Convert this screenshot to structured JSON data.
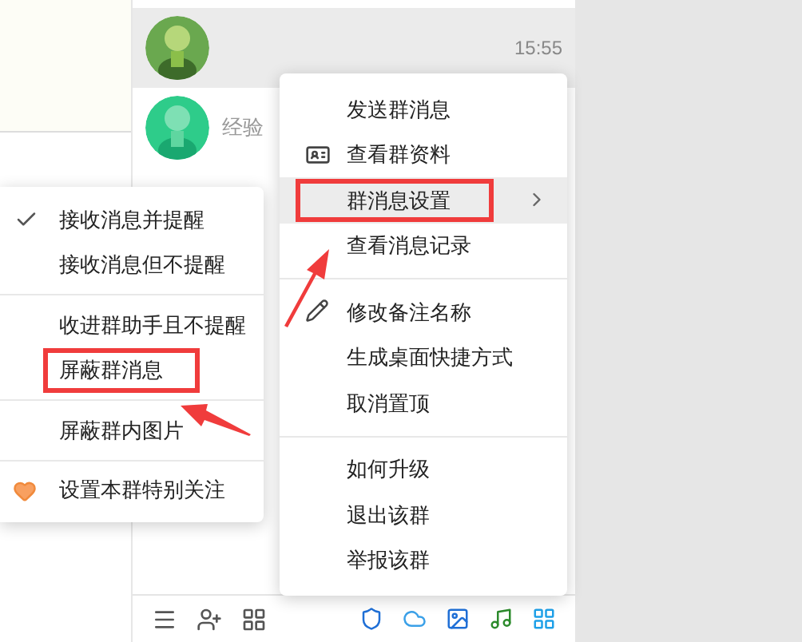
{
  "chat_list": [
    {
      "time": "15:55",
      "selected": true
    },
    {
      "name": "经验",
      "selected": false
    }
  ],
  "context_menu": {
    "groups": [
      [
        {
          "label": "发送群消息",
          "kind": "action",
          "selected": false,
          "annotated": false
        },
        {
          "label": "查看群资料",
          "kind": "action",
          "selected": false,
          "annotated": false
        },
        {
          "label": "群消息设置",
          "kind": "submenu",
          "selected": true,
          "annotated": true
        },
        {
          "label": "查看消息记录",
          "kind": "action",
          "selected": false,
          "annotated": false
        }
      ],
      [
        {
          "label": "修改备注名称",
          "kind": "action",
          "selected": false,
          "annotated": false
        },
        {
          "label": "生成桌面快捷方式",
          "kind": "action",
          "selected": false,
          "annotated": false
        },
        {
          "label": "取消置顶",
          "kind": "action",
          "selected": false,
          "annotated": false
        }
      ],
      [
        {
          "label": "如何升级",
          "kind": "action",
          "selected": false,
          "annotated": false
        },
        {
          "label": "退出该群",
          "kind": "action",
          "selected": false,
          "annotated": false
        },
        {
          "label": "举报该群",
          "kind": "action",
          "selected": false,
          "annotated": false
        }
      ]
    ]
  },
  "submenu": {
    "groups": [
      [
        {
          "label": "接收消息并提醒",
          "checked": true,
          "annotated": false
        },
        {
          "label": "接收消息但不提醒",
          "checked": false,
          "annotated": false
        }
      ],
      [
        {
          "label": "收进群助手且不提醒",
          "checked": false,
          "annotated": false
        },
        {
          "label": "屏蔽群消息",
          "checked": false,
          "annotated": true
        }
      ],
      [
        {
          "label": "屏蔽群内图片",
          "checked": false,
          "annotated": false
        }
      ],
      [
        {
          "label": "设置本群特别关注",
          "checked": false,
          "annotated": false
        }
      ]
    ]
  }
}
